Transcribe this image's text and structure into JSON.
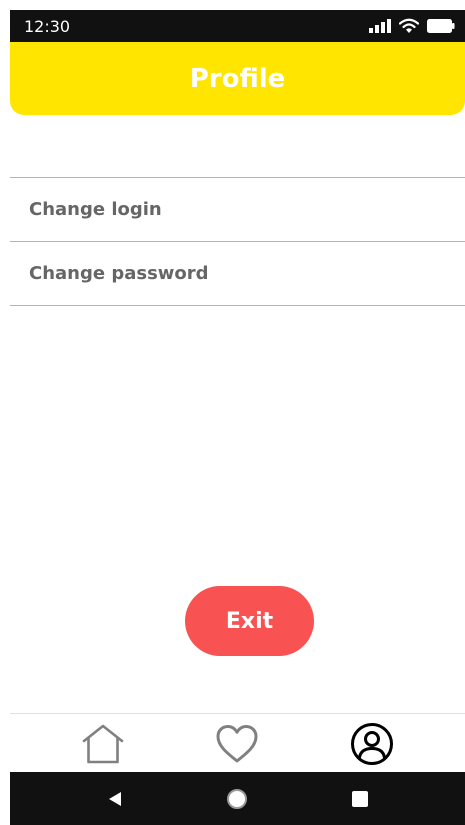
{
  "status_bar": {
    "time": "12:30",
    "icons": [
      "signal-icon",
      "wifi-icon",
      "battery-icon"
    ]
  },
  "header": {
    "title": "Profile"
  },
  "menu": {
    "items": [
      {
        "label": "Change login"
      },
      {
        "label": "Change password"
      }
    ]
  },
  "actions": {
    "exit_label": "Exit"
  },
  "tab_bar": {
    "tabs": [
      {
        "icon": "home-icon",
        "active": false
      },
      {
        "icon": "heart-icon",
        "active": false
      },
      {
        "icon": "profile-icon",
        "active": true
      }
    ]
  },
  "nav_bar": {
    "buttons": [
      "back-icon",
      "home-circle-icon",
      "recents-icon"
    ]
  },
  "colors": {
    "header": "#FFE500",
    "exit_button": "#F85252",
    "menu_text": "#666666",
    "divider": "#B3B3B3",
    "system_bars": "#111111",
    "inactive_tab": "#808080",
    "active_tab": "#000000"
  }
}
